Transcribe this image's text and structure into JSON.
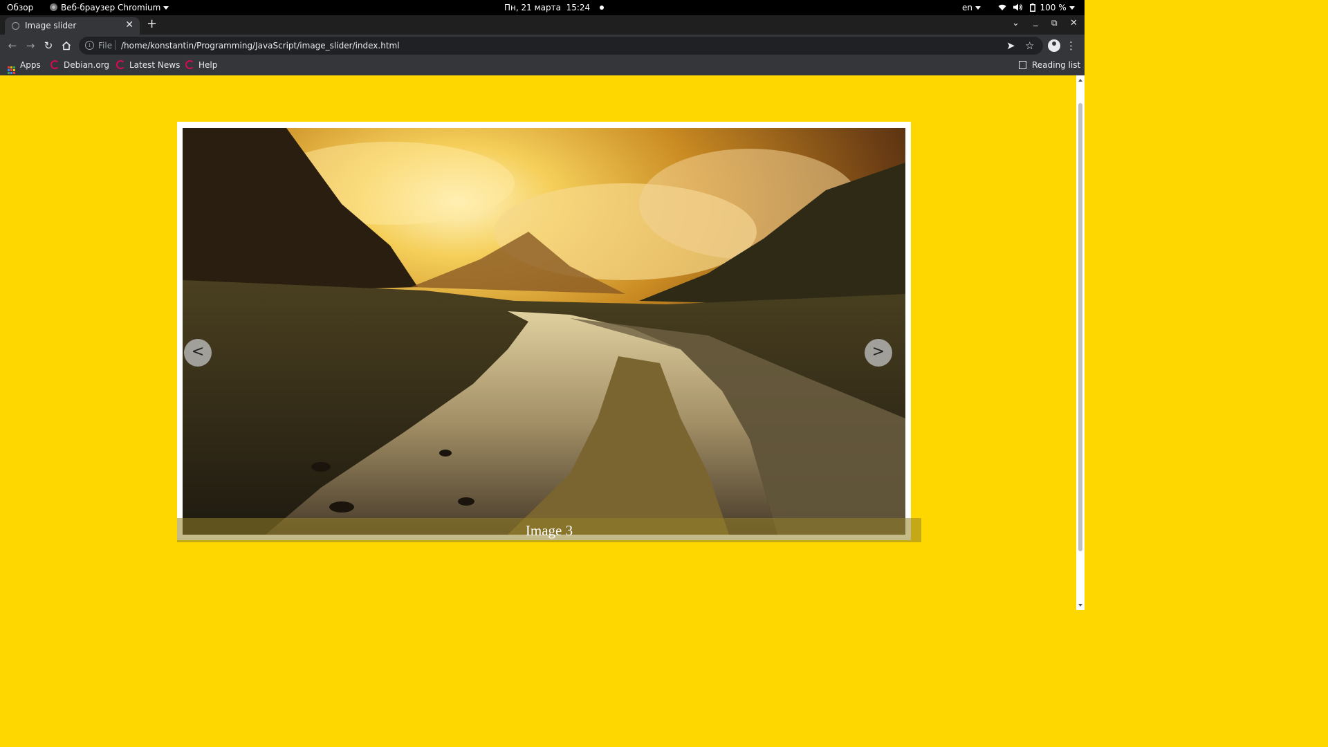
{
  "system_bar": {
    "activities": "Обзор",
    "app_menu": "Веб-браузер Chromium",
    "clock": "Пн, 21 марта  15:24",
    "keyboard_layout": "en",
    "battery": "100 %"
  },
  "browser": {
    "tab": {
      "title": "Image slider"
    },
    "address": {
      "scheme": "File",
      "url": "/home/konstantin/Programming/JavaScript/image_slider/index.html"
    },
    "bookmarks": [
      {
        "label": "Apps",
        "icon": "apps-grid-icon"
      },
      {
        "label": "Debian.org",
        "icon": "debian-swirl-icon"
      },
      {
        "label": "Latest News",
        "icon": "debian-swirl-icon"
      },
      {
        "label": "Help",
        "icon": "debian-swirl-icon"
      }
    ],
    "reading_list": "Reading list"
  },
  "page": {
    "background": "#ffd700",
    "slider": {
      "prev_label": "<",
      "next_label": ">",
      "caption": "Image 3"
    }
  }
}
